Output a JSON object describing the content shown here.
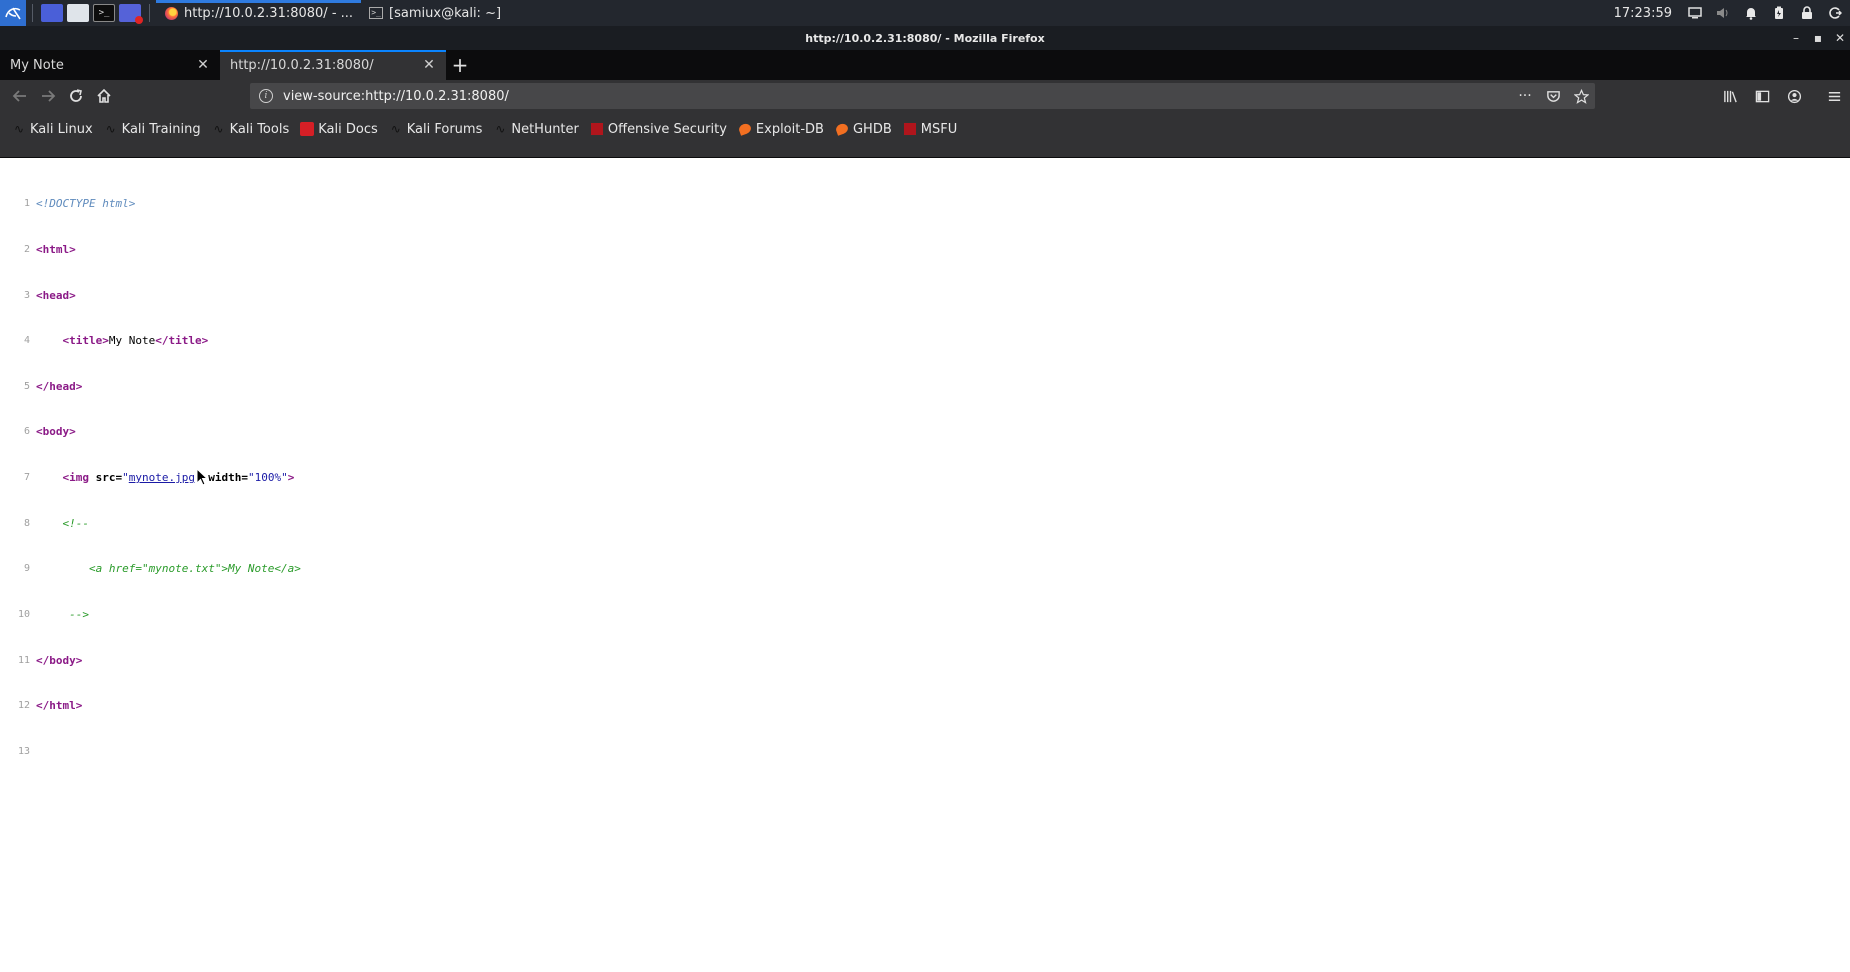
{
  "taskbar": {
    "tasks": [
      {
        "label": "http://10.0.2.31:8080/ - ..."
      },
      {
        "label": "[samiux@kali: ~]"
      }
    ],
    "clock": "17:23:59"
  },
  "window": {
    "title": "http://10.0.2.31:8080/ - Mozilla Firefox"
  },
  "tabs": [
    {
      "label": "My Note"
    },
    {
      "label": "http://10.0.2.31:8080/"
    }
  ],
  "urlbar": {
    "url": "view-source:http://10.0.2.31:8080/"
  },
  "bookmarks": [
    {
      "label": "Kali Linux",
      "icon": "kali-dragon-icon"
    },
    {
      "label": "Kali Training",
      "icon": "kali-dragon-icon"
    },
    {
      "label": "Kali Tools",
      "icon": "kali-dragon-icon"
    },
    {
      "label": "Kali Docs",
      "icon": "kali-docs-icon"
    },
    {
      "label": "Kali Forums",
      "icon": "kali-dragon-icon"
    },
    {
      "label": "NetHunter",
      "icon": "kali-dragon-icon"
    },
    {
      "label": "Offensive Security",
      "icon": "offsec-icon"
    },
    {
      "label": "Exploit-DB",
      "icon": "exploit-db-icon"
    },
    {
      "label": "GHDB",
      "icon": "exploit-db-icon"
    },
    {
      "label": "MSFU",
      "icon": "offsec-icon"
    }
  ],
  "source": {
    "line_numbers": [
      "1",
      "2",
      "3",
      "4",
      "5",
      "6",
      "7",
      "8",
      "9",
      "10",
      "11",
      "12",
      "13"
    ],
    "doctype": "<!DOCTYPE html>",
    "html_open": "<html>",
    "head_open": "<head>",
    "title_open": "<title>",
    "title_text": "My Note",
    "title_close": "</title>",
    "head_close": "</head>",
    "body_open": "<body>",
    "img_open": "<img",
    "src_attr": "src=",
    "src_val": "mynote.jpg",
    "width_attr": "width=",
    "width_val": "\"100%\"",
    "comment_open": "<!--",
    "comment_body": "<a href=\"mynote.txt\">My Note</a>",
    "comment_close": "-->",
    "body_close": "</body>",
    "html_close": "</html>"
  },
  "colors": {
    "taskbar_bg": "#23272e",
    "accent": "#0a84ff",
    "tag": "#8b1a87",
    "comment": "#2a9b2a",
    "value": "#1a1aa6"
  }
}
